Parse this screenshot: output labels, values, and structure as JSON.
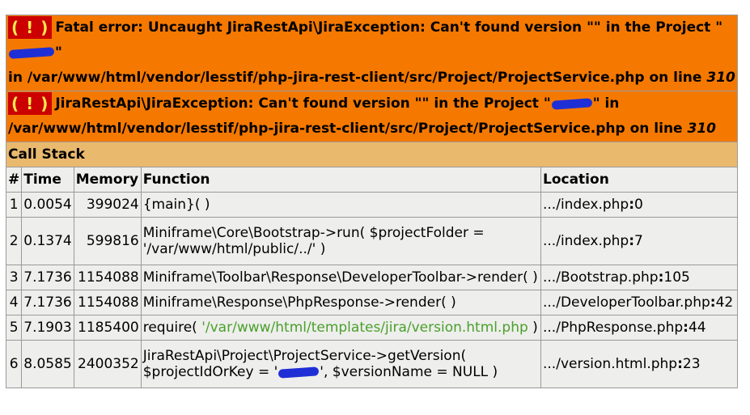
{
  "error1": {
    "badge": "( ! )",
    "text_a": "Fatal error: Uncaught JiraRestApi\\JiraException: Can't found version \"\" in the Project \"",
    "text_b": "\"",
    "text_c": "in /var/www/html/vendor/lesstif/php-jira-rest-client/src/Project/ProjectService.php on line ",
    "line": "310"
  },
  "error2": {
    "badge": "( ! )",
    "text_a": "JiraRestApi\\JiraException: Can't found version \"\" in the Project \"",
    "text_b": "\" in",
    "text_c": "/var/www/html/vendor/lesstif/php-jira-rest-client/src/Project/ProjectService.php on line ",
    "line": "310"
  },
  "call_stack": {
    "title": "Call Stack",
    "headers": {
      "idx": "#",
      "time": "Time",
      "memory": "Memory",
      "function": "Function",
      "location": "Location"
    },
    "rows": [
      {
        "idx": "1",
        "time": "0.0054",
        "memory": "399024",
        "function": "{main}( )",
        "loc_path": ".../index.php",
        "loc_line": "0"
      },
      {
        "idx": "2",
        "time": "0.1374",
        "memory": "599816",
        "function": "Miniframe\\Core\\Bootstrap->run( $projectFolder =",
        "function_2": "'/var/www/html/public/../' )",
        "loc_path": ".../index.php",
        "loc_line": "7"
      },
      {
        "idx": "3",
        "time": "7.1736",
        "memory": "1154088",
        "function": "Miniframe\\Toolbar\\Response\\DeveloperToolbar->render( )",
        "loc_path": ".../Bootstrap.php",
        "loc_line": "105"
      },
      {
        "idx": "4",
        "time": "7.1736",
        "memory": "1154088",
        "function": "Miniframe\\Response\\PhpResponse->render( )",
        "loc_path": ".../DeveloperToolbar.php",
        "loc_line": "42"
      },
      {
        "idx": "5",
        "time": "7.1903",
        "memory": "1185400",
        "function_a": "require( ",
        "function_str": "'/var/www/html/templates/jira/version.html.php",
        "function_b": " )",
        "loc_path": ".../PhpResponse.php",
        "loc_line": "44"
      },
      {
        "idx": "6",
        "time": "8.0585",
        "memory": "2400352",
        "function": "JiraRestApi\\Project\\ProjectService->getVersion(",
        "function_2a": "$projectIdOrKey = '",
        "function_2b": "', $versionName = NULL )",
        "loc_path": ".../version.html.php",
        "loc_line": "23"
      }
    ]
  },
  "colors": {
    "error_bg": "#f57900",
    "badge_bg": "#cc0000",
    "badge_fg": "#fce94f",
    "callstack_bg": "#e9b96e",
    "row_bg": "#eeeeec",
    "string_color": "#4aa02c",
    "redaction": "#1f2fd6"
  }
}
